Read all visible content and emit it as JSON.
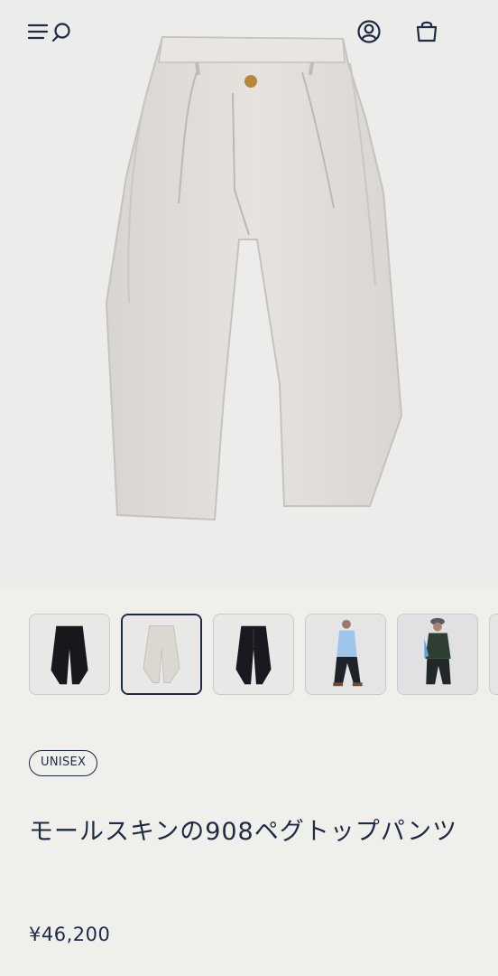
{
  "header": {
    "menu_icon": "menu-icon",
    "search_icon": "search-icon",
    "account_icon": "account-icon",
    "cart_icon": "shopping-bag-icon"
  },
  "gallery": {
    "main_color": "#e1dfdc",
    "thumbnails": [
      {
        "type": "pants-black",
        "selected": false
      },
      {
        "type": "pants-ivory",
        "selected": true
      },
      {
        "type": "pants-black-angle",
        "selected": false
      },
      {
        "type": "model-blue-shirt",
        "selected": false
      },
      {
        "type": "model-green-vest",
        "selected": false
      }
    ]
  },
  "product": {
    "badge": "UNISEX",
    "title": "モールスキンの908ペグトップパンツ",
    "price": "¥46,200"
  },
  "colors": {
    "text": "#1f2a44",
    "background": "#efefec"
  }
}
